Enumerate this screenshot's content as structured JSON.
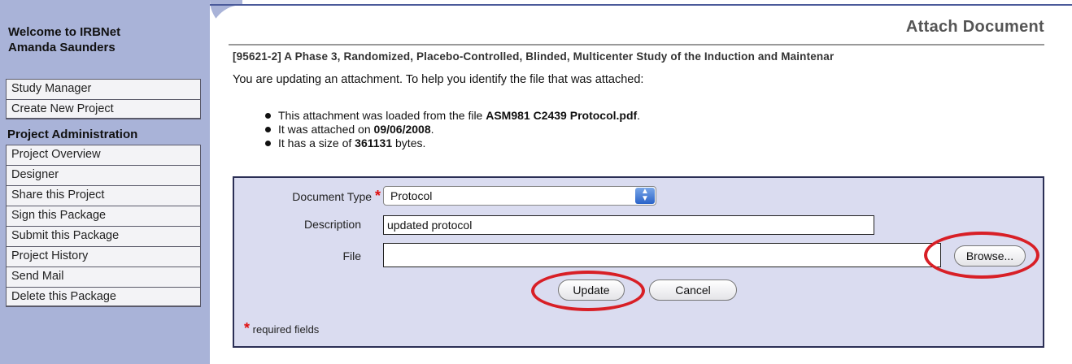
{
  "sidebar": {
    "welcome_line1": "Welcome to IRBNet",
    "welcome_line2": "Amanda Saunders",
    "top_items": [
      {
        "label": "Study Manager"
      },
      {
        "label": "Create New Project"
      }
    ],
    "section_heading": "Project Administration",
    "project_items": [
      {
        "label": "Project Overview"
      },
      {
        "label": "Designer"
      },
      {
        "label": "Share this Project"
      },
      {
        "label": "Sign this Package"
      },
      {
        "label": "Submit this Package"
      },
      {
        "label": "Project History"
      },
      {
        "label": "Send Mail"
      },
      {
        "label": "Delete this Package"
      }
    ]
  },
  "main": {
    "page_title": "Attach Document",
    "study_title": "[95621-2] A Phase 3, Randomized, Placebo-Controlled, Blinded, Multicenter Study of the Induction and Maintenar",
    "intro": "You are updating an attachment. To help you identify the file that was attached:",
    "bullets": {
      "b1_prefix": "This attachment was loaded from the file ",
      "b1_value": "ASM981 C2439 Protocol.pdf",
      "b1_suffix": ".",
      "b2_prefix": "It was attached on ",
      "b2_value": "09/06/2008",
      "b2_suffix": ".",
      "b3_prefix": "It has a size of ",
      "b3_value": "361131",
      "b3_suffix": " bytes."
    }
  },
  "form": {
    "document_type_label": "Document Type",
    "required_marker": "*",
    "document_type_value": "Protocol",
    "description_label": "Description",
    "description_value": "updated protocol",
    "file_label": "File",
    "file_value": "",
    "browse_label": "Browse...",
    "update_label": "Update",
    "cancel_label": "Cancel",
    "required_note": "required fields"
  },
  "colors": {
    "sidebar_bg": "#a9b3d8",
    "panel_bg": "#dadcf0",
    "highlight_oval": "#d81f26",
    "required_star": "#e01010"
  }
}
